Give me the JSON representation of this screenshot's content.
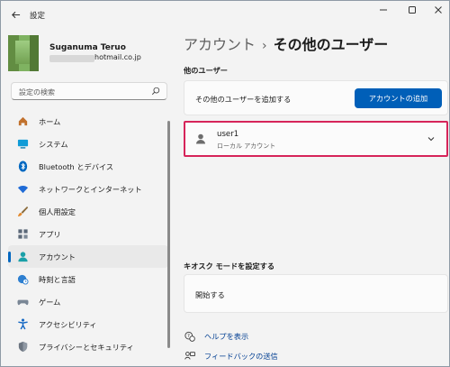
{
  "window": {
    "title": "設定",
    "back_icon": "arrow-left-icon",
    "controls": {
      "minimize": "minimize-icon",
      "maximize": "maximize-icon",
      "close": "close-icon"
    }
  },
  "user": {
    "name": "Suganuma Teruo",
    "email_visible": "hotmail.co.jp"
  },
  "search": {
    "placeholder": "設定の検索",
    "icon": "search-icon"
  },
  "nav": {
    "items": [
      {
        "label": "ホーム",
        "icon": "home-icon",
        "color": "#c1712d",
        "active": false
      },
      {
        "label": "システム",
        "icon": "system-icon",
        "color": "#0f9bd7",
        "active": false
      },
      {
        "label": "Bluetooth とデバイス",
        "icon": "bluetooth-icon",
        "color": "#0067c0",
        "active": false
      },
      {
        "label": "ネットワークとインターネット",
        "icon": "wifi-icon",
        "color": "#1f6bd6",
        "active": false
      },
      {
        "label": "個人用設定",
        "icon": "brush-icon",
        "color": "#e3882b",
        "active": false
      },
      {
        "label": "アプリ",
        "icon": "apps-icon",
        "color": "#5a6777",
        "active": false
      },
      {
        "label": "アカウント",
        "icon": "account-icon",
        "color": "#1aa0a8",
        "active": true
      },
      {
        "label": "時刻と言語",
        "icon": "globe-clock-icon",
        "color": "#2d7fd0",
        "active": false
      },
      {
        "label": "ゲーム",
        "icon": "gamepad-icon",
        "color": "#7a8796",
        "active": false
      },
      {
        "label": "アクセシビリティ",
        "icon": "accessibility-icon",
        "color": "#1769c4",
        "active": false
      },
      {
        "label": "プライバシーとセキュリティ",
        "icon": "shield-icon",
        "color": "#6b7480",
        "active": false
      }
    ]
  },
  "main": {
    "breadcrumb": {
      "parent": "アカウント",
      "separator": "›",
      "current": "その他のユーザー"
    },
    "other_users": {
      "section_title": "他のユーザー",
      "add_label": "その他のユーザーを追加する",
      "add_button": "アカウントの追加",
      "account": {
        "name": "user1",
        "type": "ローカル アカウント"
      }
    },
    "kiosk": {
      "section_title": "キオスク モードを設定する",
      "start_label": "開始する"
    },
    "links": [
      {
        "label": "ヘルプを表示",
        "icon": "help-icon"
      },
      {
        "label": "フィードバックの送信",
        "icon": "feedback-icon"
      }
    ]
  },
  "colors": {
    "accent": "#005fb8",
    "highlight_border": "#d6245a",
    "link": "#003e92"
  }
}
